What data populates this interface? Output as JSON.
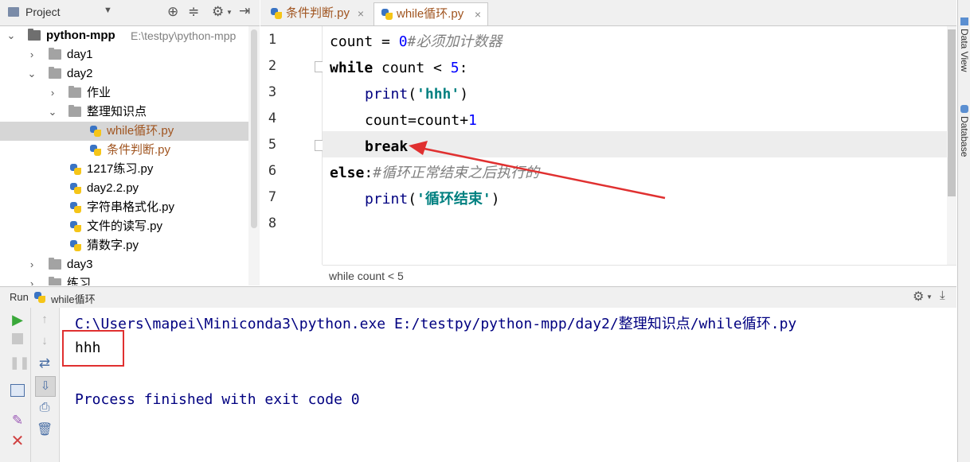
{
  "project_panel": {
    "title": "Project",
    "tree": [
      {
        "label": "python-mpp",
        "path": "E:\\testpy\\python-mpp"
      },
      {
        "label": "day1"
      },
      {
        "label": "day2"
      },
      {
        "label": "作业"
      },
      {
        "label": "整理知识点"
      },
      {
        "label": "while循环.py"
      },
      {
        "label": "条件判断.py"
      },
      {
        "label": "1217练习.py"
      },
      {
        "label": "day2.2.py"
      },
      {
        "label": "字符串格式化.py"
      },
      {
        "label": "文件的读写.py"
      },
      {
        "label": "猜数字.py"
      },
      {
        "label": "day3"
      },
      {
        "label": "练习"
      }
    ]
  },
  "editor": {
    "tabs": [
      {
        "label": "条件判断.py",
        "close": "×"
      },
      {
        "label": "while循环.py",
        "close": "×"
      }
    ],
    "line_numbers": [
      "1",
      "2",
      "3",
      "4",
      "5",
      "6",
      "7",
      "8"
    ],
    "code": {
      "l1": {
        "a": "count = ",
        "num": "0",
        "comment": "#必须加计数器"
      },
      "l2": {
        "kw": "while",
        "rest": " count < ",
        "num": "5",
        "colon": ":"
      },
      "l3": {
        "fn": "print",
        "open": "(",
        "str": "'hhh'",
        "close": ")"
      },
      "l4": {
        "a": "count=count+",
        "num": "1"
      },
      "l5": {
        "kw": "break"
      },
      "l6": {
        "kw": "else",
        "colon": ":",
        "comment": "#循环正常结束之后执行的"
      },
      "l7": {
        "fn": "print",
        "open": "(",
        "str": "'循环结束'",
        "close": ")"
      }
    },
    "breadcrumb": "while count < 5"
  },
  "right_strip": {
    "data_view": "Data View",
    "database": "Database"
  },
  "run_panel": {
    "run_label": "Run",
    "config_name": "while循环",
    "console": {
      "command": "C:\\Users\\mapei\\Miniconda3\\python.exe E:/testpy/python-mpp/day2/整理知识点/while循环.py",
      "output": "hhh",
      "exit_message": "Process finished with exit code 0"
    }
  },
  "colors": {
    "annotation_red": "#e03030",
    "keyword": "#000080",
    "string": "#008080",
    "number": "#0000ff",
    "comment": "#808080",
    "modified_file": "#a0541f"
  },
  "icons": [
    "project-dropdown-icon",
    "locate-icon",
    "collapse-icon",
    "gear-icon",
    "hide-icon",
    "rerun-icon",
    "stop-icon",
    "pause-icon",
    "scroll-up-icon",
    "scroll-down-icon",
    "soft-wrap-icon",
    "layout-icon",
    "scroll-to-end-icon",
    "print-icon",
    "pin-icon",
    "close-icon",
    "trash-icon",
    "run-settings-gear-icon",
    "minimize-icon"
  ]
}
